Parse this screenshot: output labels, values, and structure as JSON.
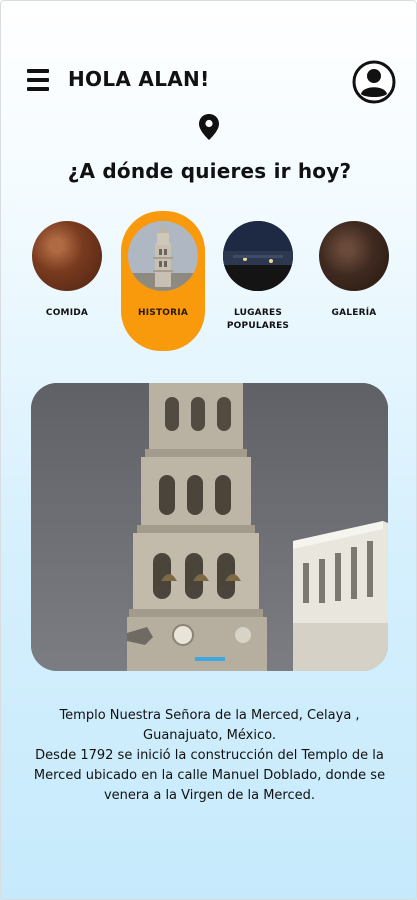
{
  "header": {
    "greeting": "HOLA ALAN!"
  },
  "icons": {
    "menu": "hamburger-menu-icon",
    "profile": "user-profile-icon",
    "location": "map-pin-icon"
  },
  "prompt": "¿A dónde quieres ir hoy?",
  "categories": [
    {
      "label": "COMIDA",
      "active": false
    },
    {
      "label": "HISTORIA",
      "active": true
    },
    {
      "label": "LUGARES POPULARES",
      "active": false
    },
    {
      "label": "GALERÍA",
      "active": false
    }
  ],
  "colors": {
    "accent": "#f99a0d",
    "text": "#111111",
    "background_top": "#ffffff",
    "background_bottom": "#c6eafc"
  },
  "feature": {
    "description_line1": "Templo Nuestra Señora de la Merced, Celaya , Guanajuato, México.",
    "description_line2": "Desde 1792 se inició la construcción del Templo de la Merced ubicado en la calle Manuel Doblado, donde se venera a la Virgen de la Merced."
  }
}
